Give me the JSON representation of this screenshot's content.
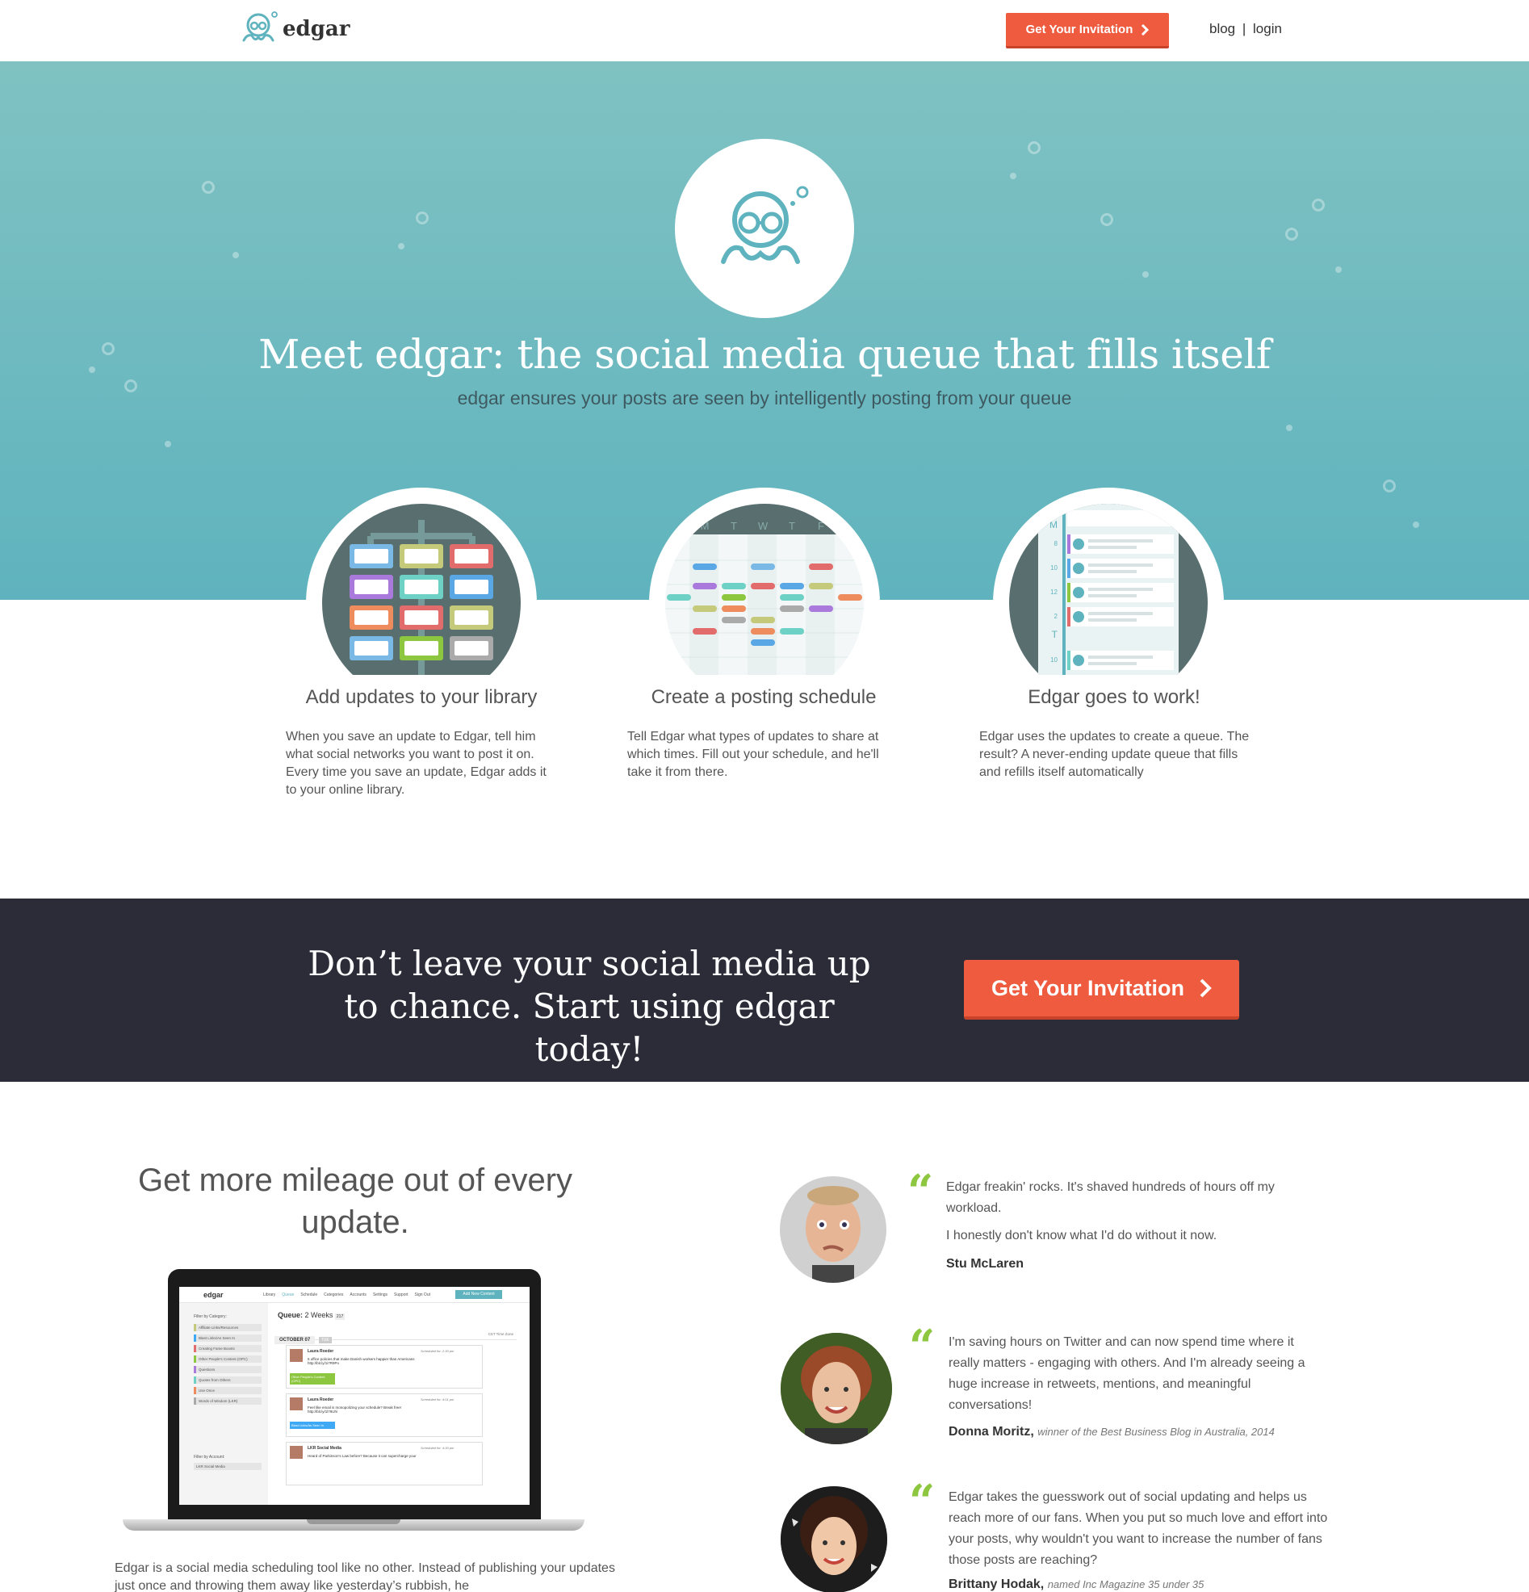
{
  "header": {
    "brand": "edgar",
    "cta_label": "Get Your Invitation",
    "blog_link": "blog",
    "separator": "|",
    "login_link": "login"
  },
  "hero": {
    "title": "Meet edgar: the social media queue that fills itself",
    "subtitle": "edgar ensures your posts are seen by intelligently posting from your queue"
  },
  "features": [
    {
      "title": "Add updates to your library",
      "description": "When you save an update to Edgar, tell him what social networks you want to post it on. Every time you save an update, Edgar adds it to your online library."
    },
    {
      "title": "Create a posting schedule",
      "description": "Tell Edgar what types of updates to share at which times. Fill out your schedule, and he'll take it from there."
    },
    {
      "title": "Edgar goes to work!",
      "description": "Edgar uses the updates to create a queue. The result? A never-ending update queue that fills and refills itself automatically"
    }
  ],
  "schedule_days": [
    "M",
    "T",
    "W",
    "T",
    "F"
  ],
  "queue_labels": [
    "M",
    "8",
    "10",
    "12",
    "2",
    "T",
    "10"
  ],
  "cta_band": {
    "text": "Don’t leave your social media up to chance. Start using edgar today!",
    "button_label": "Get Your Invitation"
  },
  "mileage": {
    "title": "Get more mileage out of every update.",
    "description": "Edgar is a social media scheduling tool like no other. Instead of publishing your updates just once and throwing them away like yesterday’s rubbish, he"
  },
  "laptop_screen": {
    "brand": "edgar",
    "nav": [
      "Library",
      "Queue",
      "Schedule",
      "Categories",
      "Accounts",
      "Settings",
      "Support",
      "Sign Out"
    ],
    "add_button": "Add New Content",
    "filter_label": "Filter by Category:",
    "categories": [
      "Affiliate Links/Resources",
      "Blast Links/As Seen In",
      "Creating Fame Boosts",
      "Other People's Content (OPC)",
      "Questions",
      "Quotes from Others",
      "Use Once",
      "Words of Wisdom (LKR)"
    ],
    "filter_account_label": "Filter by Account:",
    "account": "LKR Social Media",
    "queue_title": "Queue:",
    "queue_range": "2 Weeks",
    "queue_count": "217",
    "date_label": "OCTOBER 07",
    "date_tag": "TUE",
    "timezone": "CST Time Zone",
    "posts": [
      {
        "author": "Laura Roeder",
        "time": "Scheduled for: 2:30 pm",
        "text": "5 office policies that make Danish workers happier than Americans http://bit.ly/1i7R9Po",
        "tag": "Other People's Content (OPC)",
        "tag_color": "#8dc63f"
      },
      {
        "author": "Laura Roeder",
        "time": "Scheduled for: 4:01 pm",
        "text": "Feel like email is monopolizing your schedule? Break free! http://bit.ly/1l76Uhi",
        "tag": "Blast Links/As Seen In",
        "tag_color": "#3fa9f5"
      },
      {
        "author": "LKR Social Media",
        "time": "Scheduled for: 4:30 pm",
        "text": "Heard of Parkinson's Law before? Because it can supercharge your",
        "tag": "",
        "tag_color": ""
      }
    ]
  },
  "testimonials": [
    {
      "paragraphs": [
        "Edgar freakin' rocks. It's shaved hundreds of hours off my workload.",
        "I honestly don't know what I'd do without it now."
      ],
      "author": "Stu McLaren",
      "credit": ""
    },
    {
      "paragraphs": [
        "I'm saving hours on Twitter and can now spend time where it really matters - engaging with others. And I'm already seeing a huge increase in retweets, mentions, and meaningful conversations!"
      ],
      "author": "Donna Moritz,",
      "credit": "winner of the Best Business Blog in Australia, 2014"
    },
    {
      "paragraphs": [
        "Edgar takes the guesswork out of social updating and helps us reach more of our fans. When you put so much love and effort into your posts, why wouldn't you want to increase the number of fans those posts are reaching?"
      ],
      "author": "Brittany Hodak,",
      "credit": "named Inc Magazine 35 under 35"
    }
  ],
  "colors": {
    "accent": "#ee5b3f",
    "hero_top": "#80c2c2",
    "hero_bottom": "#5fb3be",
    "dark_band": "#2b2c38",
    "quote_green": "#8dc63f",
    "brand_teal": "#5fb3be"
  },
  "icons": {
    "logo": "octopus-icon",
    "chevron": "chevron-right-icon",
    "quote": "quote-icon"
  }
}
